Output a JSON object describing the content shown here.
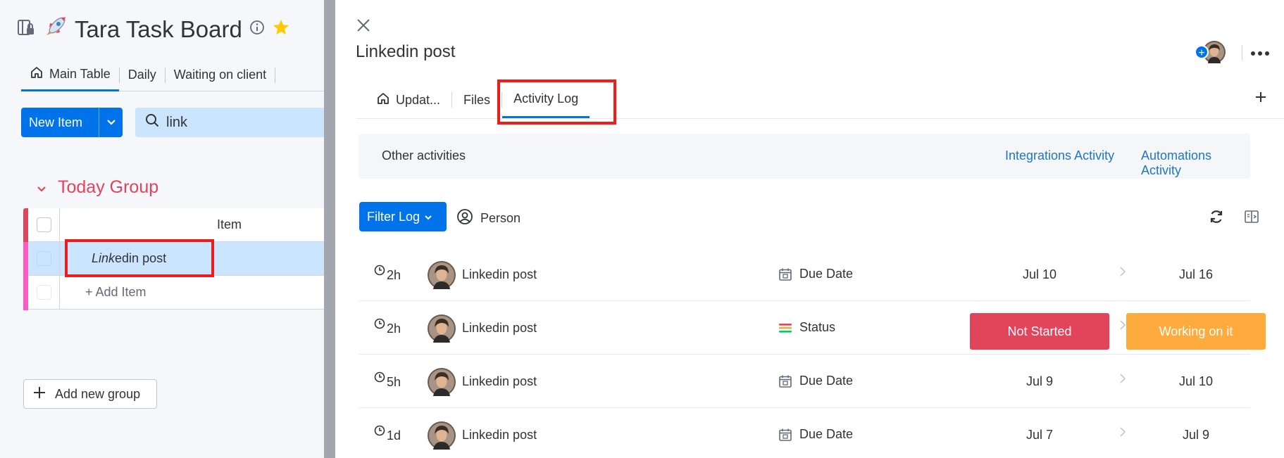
{
  "board": {
    "title": "Tara Task Board",
    "tabs": [
      {
        "label": "Main Table"
      },
      {
        "label": "Daily"
      },
      {
        "label": "Waiting on client"
      }
    ],
    "new_item_label": "New Item",
    "search_value": "link",
    "group": {
      "title": "Today Group",
      "column_header": "Item",
      "item_prefix": "Link",
      "item_suffix": "edin post",
      "add_item_label": "+ Add Item"
    },
    "add_group_label": "Add new group"
  },
  "panel": {
    "title": "Linkedin post",
    "tabs": [
      {
        "label": "Updat..."
      },
      {
        "label": "Files"
      },
      {
        "label": "Activity Log"
      }
    ],
    "other_activities_label": "Other activities",
    "integrations_link": "Integrations Activity",
    "automations_link": "Automations Activity",
    "filter_label": "Filter Log",
    "person_label": "Person",
    "rows": [
      {
        "time": "2h",
        "item": "Linkedin post",
        "column": "Due Date",
        "old": "Jul 10",
        "new": "Jul 16"
      },
      {
        "time": "2h",
        "item": "Linkedin post",
        "column": "Status",
        "old": "Not Started",
        "new": "Working on it"
      },
      {
        "time": "5h",
        "item": "Linkedin post",
        "column": "Due Date",
        "old": "Jul 9",
        "new": "Jul 10"
      },
      {
        "time": "1d",
        "item": "Linkedin post",
        "column": "Due Date",
        "old": "Jul 7",
        "new": "Jul 9"
      }
    ]
  },
  "colors": {
    "primary": "#0073ea",
    "group": "#e2445c",
    "status_not_started": "#e2445c",
    "status_working": "#fdab3d",
    "highlight": "#ef1c1c"
  }
}
